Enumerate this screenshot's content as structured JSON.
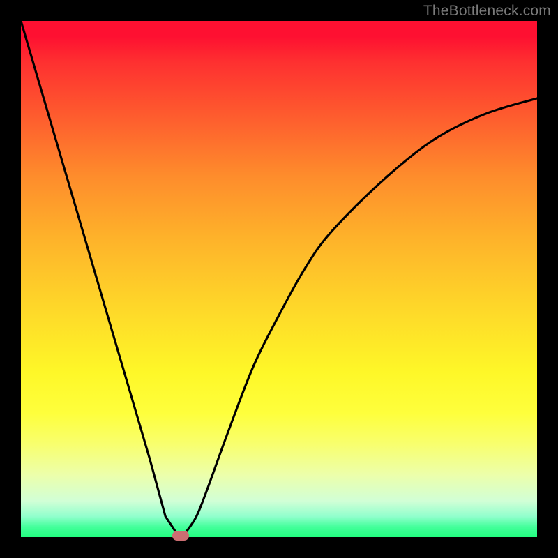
{
  "watermark": "TheBottleneck.com",
  "chart_data": {
    "type": "line",
    "title": "",
    "xlabel": "",
    "ylabel": "",
    "xlim": [
      0,
      100
    ],
    "ylim": [
      0,
      100
    ],
    "series": [
      {
        "name": "bottleneck-curve",
        "x": [
          0,
          5,
          10,
          15,
          20,
          25,
          28,
          30,
          31,
          32,
          34,
          36,
          40,
          45,
          50,
          55,
          60,
          70,
          80,
          90,
          100
        ],
        "values": [
          100,
          83,
          66,
          49,
          32,
          15,
          4,
          1,
          0,
          1,
          4,
          9,
          20,
          33,
          43,
          52,
          59,
          69,
          77,
          82,
          85
        ]
      }
    ],
    "marker": {
      "x": 31,
      "y": 0,
      "color": "#cc6e72"
    },
    "gradient_stops": [
      {
        "pct": 0,
        "color": "#fe1031"
      },
      {
        "pct": 3,
        "color": "#fe1031"
      },
      {
        "pct": 8,
        "color": "#fe3030"
      },
      {
        "pct": 18,
        "color": "#fe5a2e"
      },
      {
        "pct": 30,
        "color": "#fe8c2c"
      },
      {
        "pct": 42,
        "color": "#feb22a"
      },
      {
        "pct": 55,
        "color": "#fed629"
      },
      {
        "pct": 68,
        "color": "#fef728"
      },
      {
        "pct": 76,
        "color": "#feff3c"
      },
      {
        "pct": 82,
        "color": "#f8ff6e"
      },
      {
        "pct": 88,
        "color": "#ecffab"
      },
      {
        "pct": 93,
        "color": "#d1ffd6"
      },
      {
        "pct": 96,
        "color": "#91ffcd"
      },
      {
        "pct": 98,
        "color": "#44ff9b"
      },
      {
        "pct": 100,
        "color": "#22fe80"
      }
    ]
  }
}
